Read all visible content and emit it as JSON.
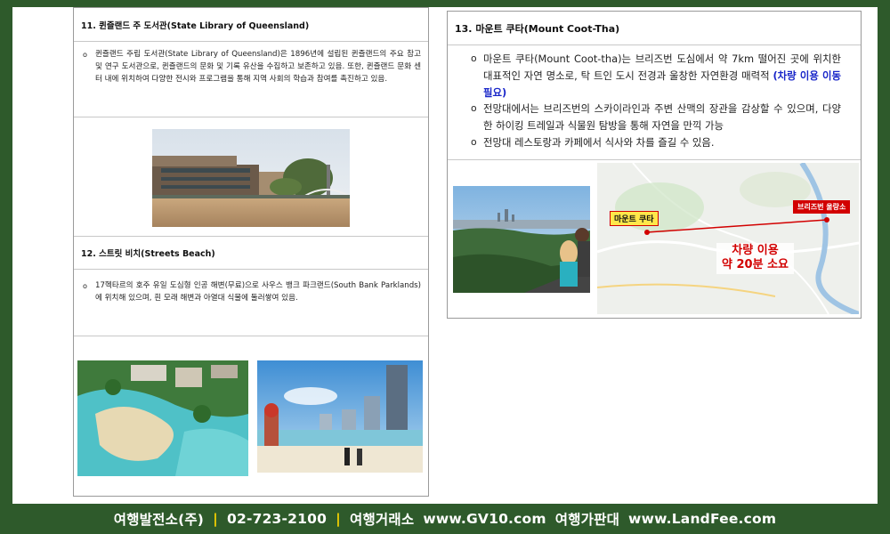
{
  "section11": {
    "title": "11. 퀸즐랜드 주 도서관(State Library of Queensland)",
    "bullets": [
      "퀸즐랜드 주립 도서관(State Library of Queensland)은 1896년에 설립된 퀸즐랜드의 주요 참고 및 연구 도서관으로, 퀸즐랜드의 문화 및 기록 유산을 수집하고 보존하고 있음. 또한, 퀸즐랜드 문화 센터 내에 위치하여 다양한 전시와 프로그램을 통해 지역 사회의 학습과 참여를 촉진하고 있음."
    ]
  },
  "section12": {
    "title": "12. 스트릿 비치(Streets Beach)",
    "bullets": [
      "17헥타르의 호주 유일 도심형 인공 해변(무료)으로 사우스 뱅크 파크랜드(South Bank Parklands)에 위치해 있으며, 흰 모래 해변과 아열대 식물에 둘러쌓여 있음."
    ]
  },
  "section13": {
    "title": "13. 마운트 쿠타(Mount Coot-Tha)",
    "bullet1": "마운트 쿠타(Mount Coot-tha)는 브리즈번 도심에서 약 7km 떨어진 곳에 위치한 대표적인 자연 명소로, 탁 트인 도시 전경과 울창한 자연환경 매력적",
    "bullet1_highlight": "(차량 이용 이동 필요)",
    "bullet2": "전망대에서는 브리즈번의 스카이라인과 주변 산맥의 장관을 감상할 수 있으며, 다양한 하이킹 트레일과 식물원 탐방을 통해 자연을 만끽 가능",
    "bullet3": "전망대 레스토랑과 카페에서 식사와 차를 즐길 수 있음.",
    "map": {
      "start_label": "마운트 쿠타",
      "end_label": "브리즈번 울랑소",
      "route_line1": "차량 이용",
      "route_line2": "약 20분 소요"
    }
  },
  "footer": {
    "company": "여행발전소(주)",
    "phone": "02-723-2100",
    "exchange_label": "여행거래소",
    "exchange_url": "www.GV10.com",
    "market_label": "여행가판대",
    "market_url": "www.LandFee.com",
    "separator": "|"
  },
  "colors": {
    "frame": "#2e5a2b",
    "highlight_blue": "#1a27c9",
    "map_red": "#d20000",
    "separator_yellow": "#f5d000"
  }
}
